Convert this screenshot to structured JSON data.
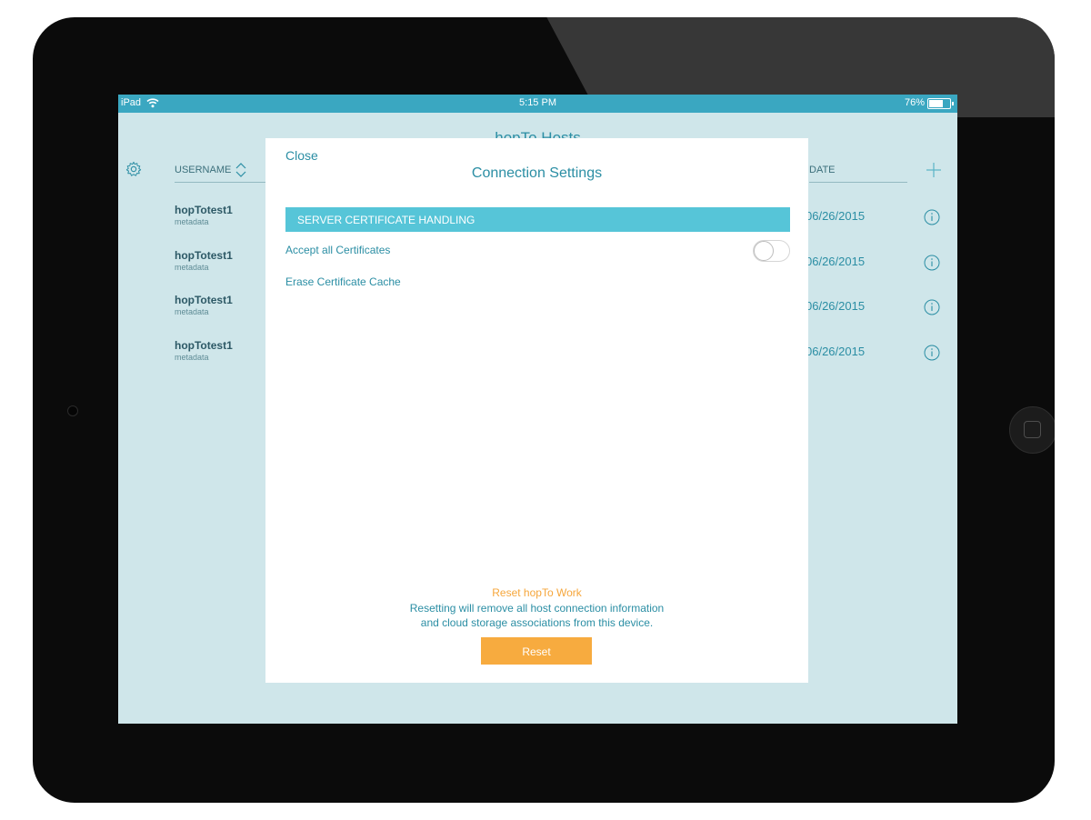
{
  "status_bar": {
    "carrier": "iPad",
    "time": "5:15 PM",
    "battery": "76%",
    "battery_level": 0.76
  },
  "app": {
    "title": "hopTo Hosts",
    "columns": {
      "username": "USERNAME",
      "date": "DATE"
    },
    "hosts": [
      {
        "name": "hopTotest1",
        "meta": "metadata",
        "date": "06/26/2015"
      },
      {
        "name": "hopTotest1",
        "meta": "metadata",
        "date": "06/26/2015"
      },
      {
        "name": "hopTotest1",
        "meta": "metadata",
        "date": "06/26/2015"
      },
      {
        "name": "hopTotest1",
        "meta": "metadata",
        "date": "06/26/2015"
      }
    ]
  },
  "modal": {
    "close_label": "Close",
    "title": "Connection Settings",
    "section_header": "SERVER CERTIFICATE HANDLING",
    "accept_label": "Accept all Certificates",
    "accept_enabled": false,
    "erase_label": "Erase Certificate Cache",
    "reset_title": "Reset hopTo Work",
    "reset_desc_line1": "Resetting will remove all host connection information",
    "reset_desc_line2": "and cloud storage associations from this device.",
    "reset_button": "Reset"
  },
  "colors": {
    "accent": "#2b8ea4",
    "section_bg": "#56c5d8",
    "reset_orange": "#f7ab3f",
    "screen_bg": "#cfe6ea",
    "status_bar": "#3aa7c1"
  },
  "icons": [
    "wifi-icon",
    "battery-icon",
    "gear-icon",
    "sort-icon",
    "add-icon",
    "info-icon",
    "home-button-icon",
    "camera-icon"
  ]
}
